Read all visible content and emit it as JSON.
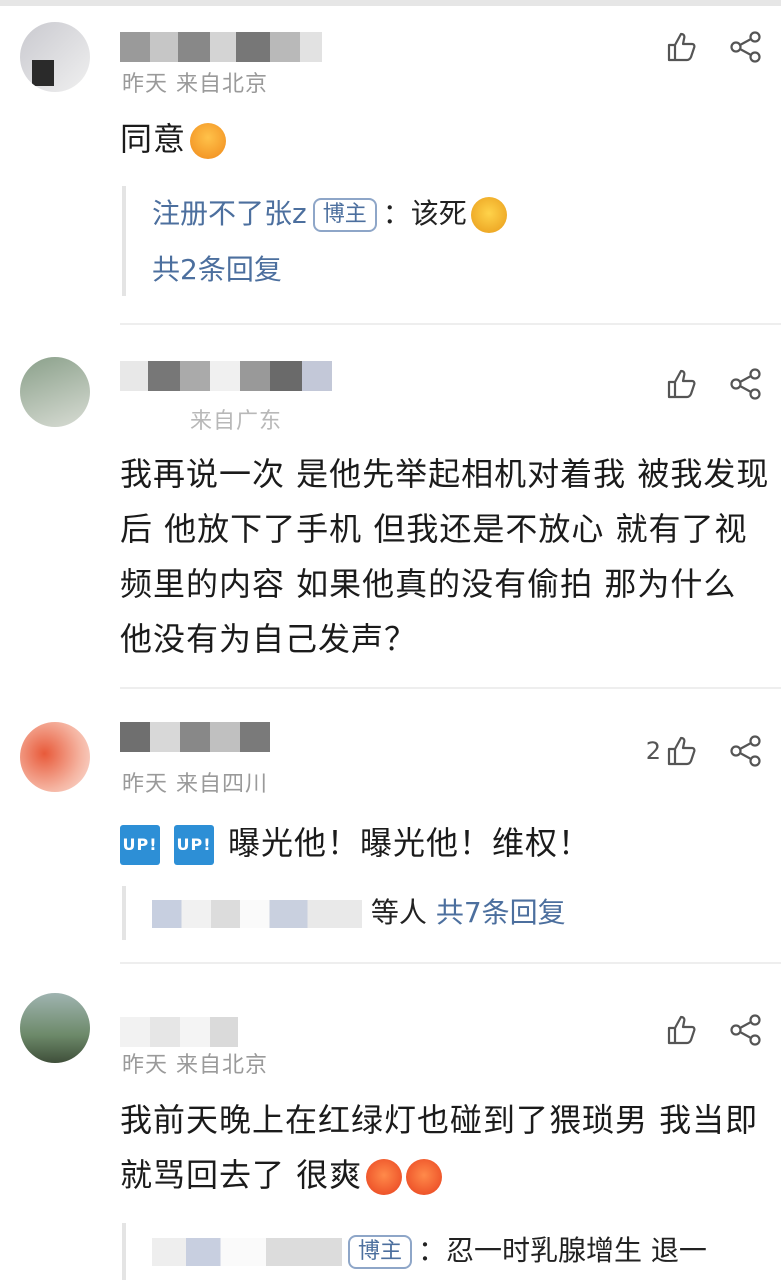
{
  "comments": [
    {
      "meta": "昨天 来自北京",
      "text": "同意",
      "emoji": "raising-hands-emoji",
      "reply": {
        "name": "注册不了张z",
        "badge": "博主",
        "text": "：该死",
        "emoji": "crying-face-emoji",
        "count": "共2条回复"
      }
    },
    {
      "meta": "来自广东",
      "text": "我再说一次 是他先举起相机对着我 被我发现后 他放下了手机 但我还是不放心 就有了视频里的内容 如果他真的没有偷拍 那为什么 他没有为自己发声？"
    },
    {
      "meta": "昨天 来自四川",
      "likes": "2",
      "badges": [
        "UP!",
        "UP!"
      ],
      "text": "曝光他！曝光他！维权！",
      "reply_summary": {
        "suffix": "等人",
        "count": "共7条回复"
      }
    },
    {
      "meta": "昨天 来自北京",
      "text": "我前天晚上在红绿灯也碰到了猥琐男 我当即就骂回去了 很爽",
      "emoji": "angry-face-emoji",
      "reply": {
        "badge": "博主",
        "text": "：忍一时乳腺增生 退一"
      }
    }
  ],
  "icons": {
    "like": "thumbs-up-icon",
    "share": "share-icon"
  },
  "colors": {
    "link": "#4c6f9e",
    "meta": "#9a9a9a",
    "text": "#1b1b1b"
  }
}
